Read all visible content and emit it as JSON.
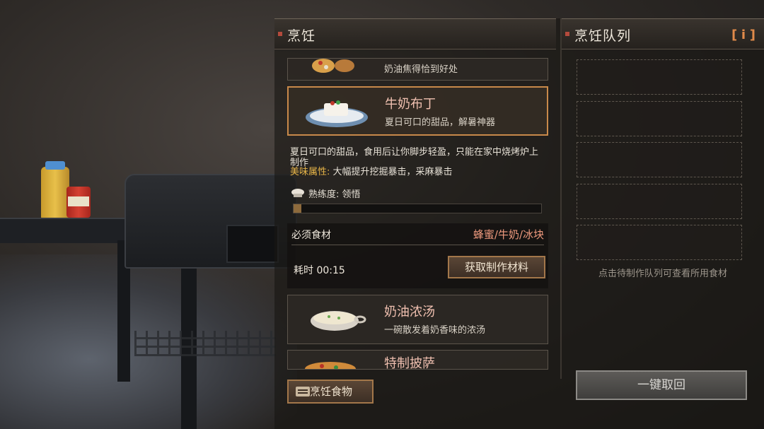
{
  "cook_panel": {
    "title": "烹饪",
    "top_card_desc": "奶油焦得恰到好处",
    "selected": {
      "name": "牛奶布丁",
      "desc": "夏日可口的甜品，解暑神器",
      "detail": "夏日可口的甜品，食用后让你脚步轻盈，只能在家中烧烤炉上制作",
      "attr_label": "美味属性:",
      "attr_value": "大幅提升挖掘暴击，采麻暴击",
      "proficiency": "熟练度: 领悟",
      "proficiency_progress": 0.03,
      "ingredients_label": "必须食材",
      "ingredients": "蜂蜜/牛奶/冰块",
      "time": "耗时 00:15",
      "get_materials": "获取制作材料"
    },
    "soup": {
      "name": "奶油浓汤",
      "desc": "一碗散发着奶香味的浓汤"
    },
    "pizza": {
      "name": "特制披萨"
    },
    "cook_button": "烹饪食物"
  },
  "queue_panel": {
    "title": "烹饪队列",
    "info_icon": "i",
    "slots": 5,
    "hint": "点击待制作队列可查看所用食材",
    "recall_button": "一键取回"
  },
  "colors": {
    "accent": "#c8894a",
    "title_mark": "#b44a3c",
    "ingredient": "#ef9a7e",
    "attribute": "#e8b548"
  }
}
